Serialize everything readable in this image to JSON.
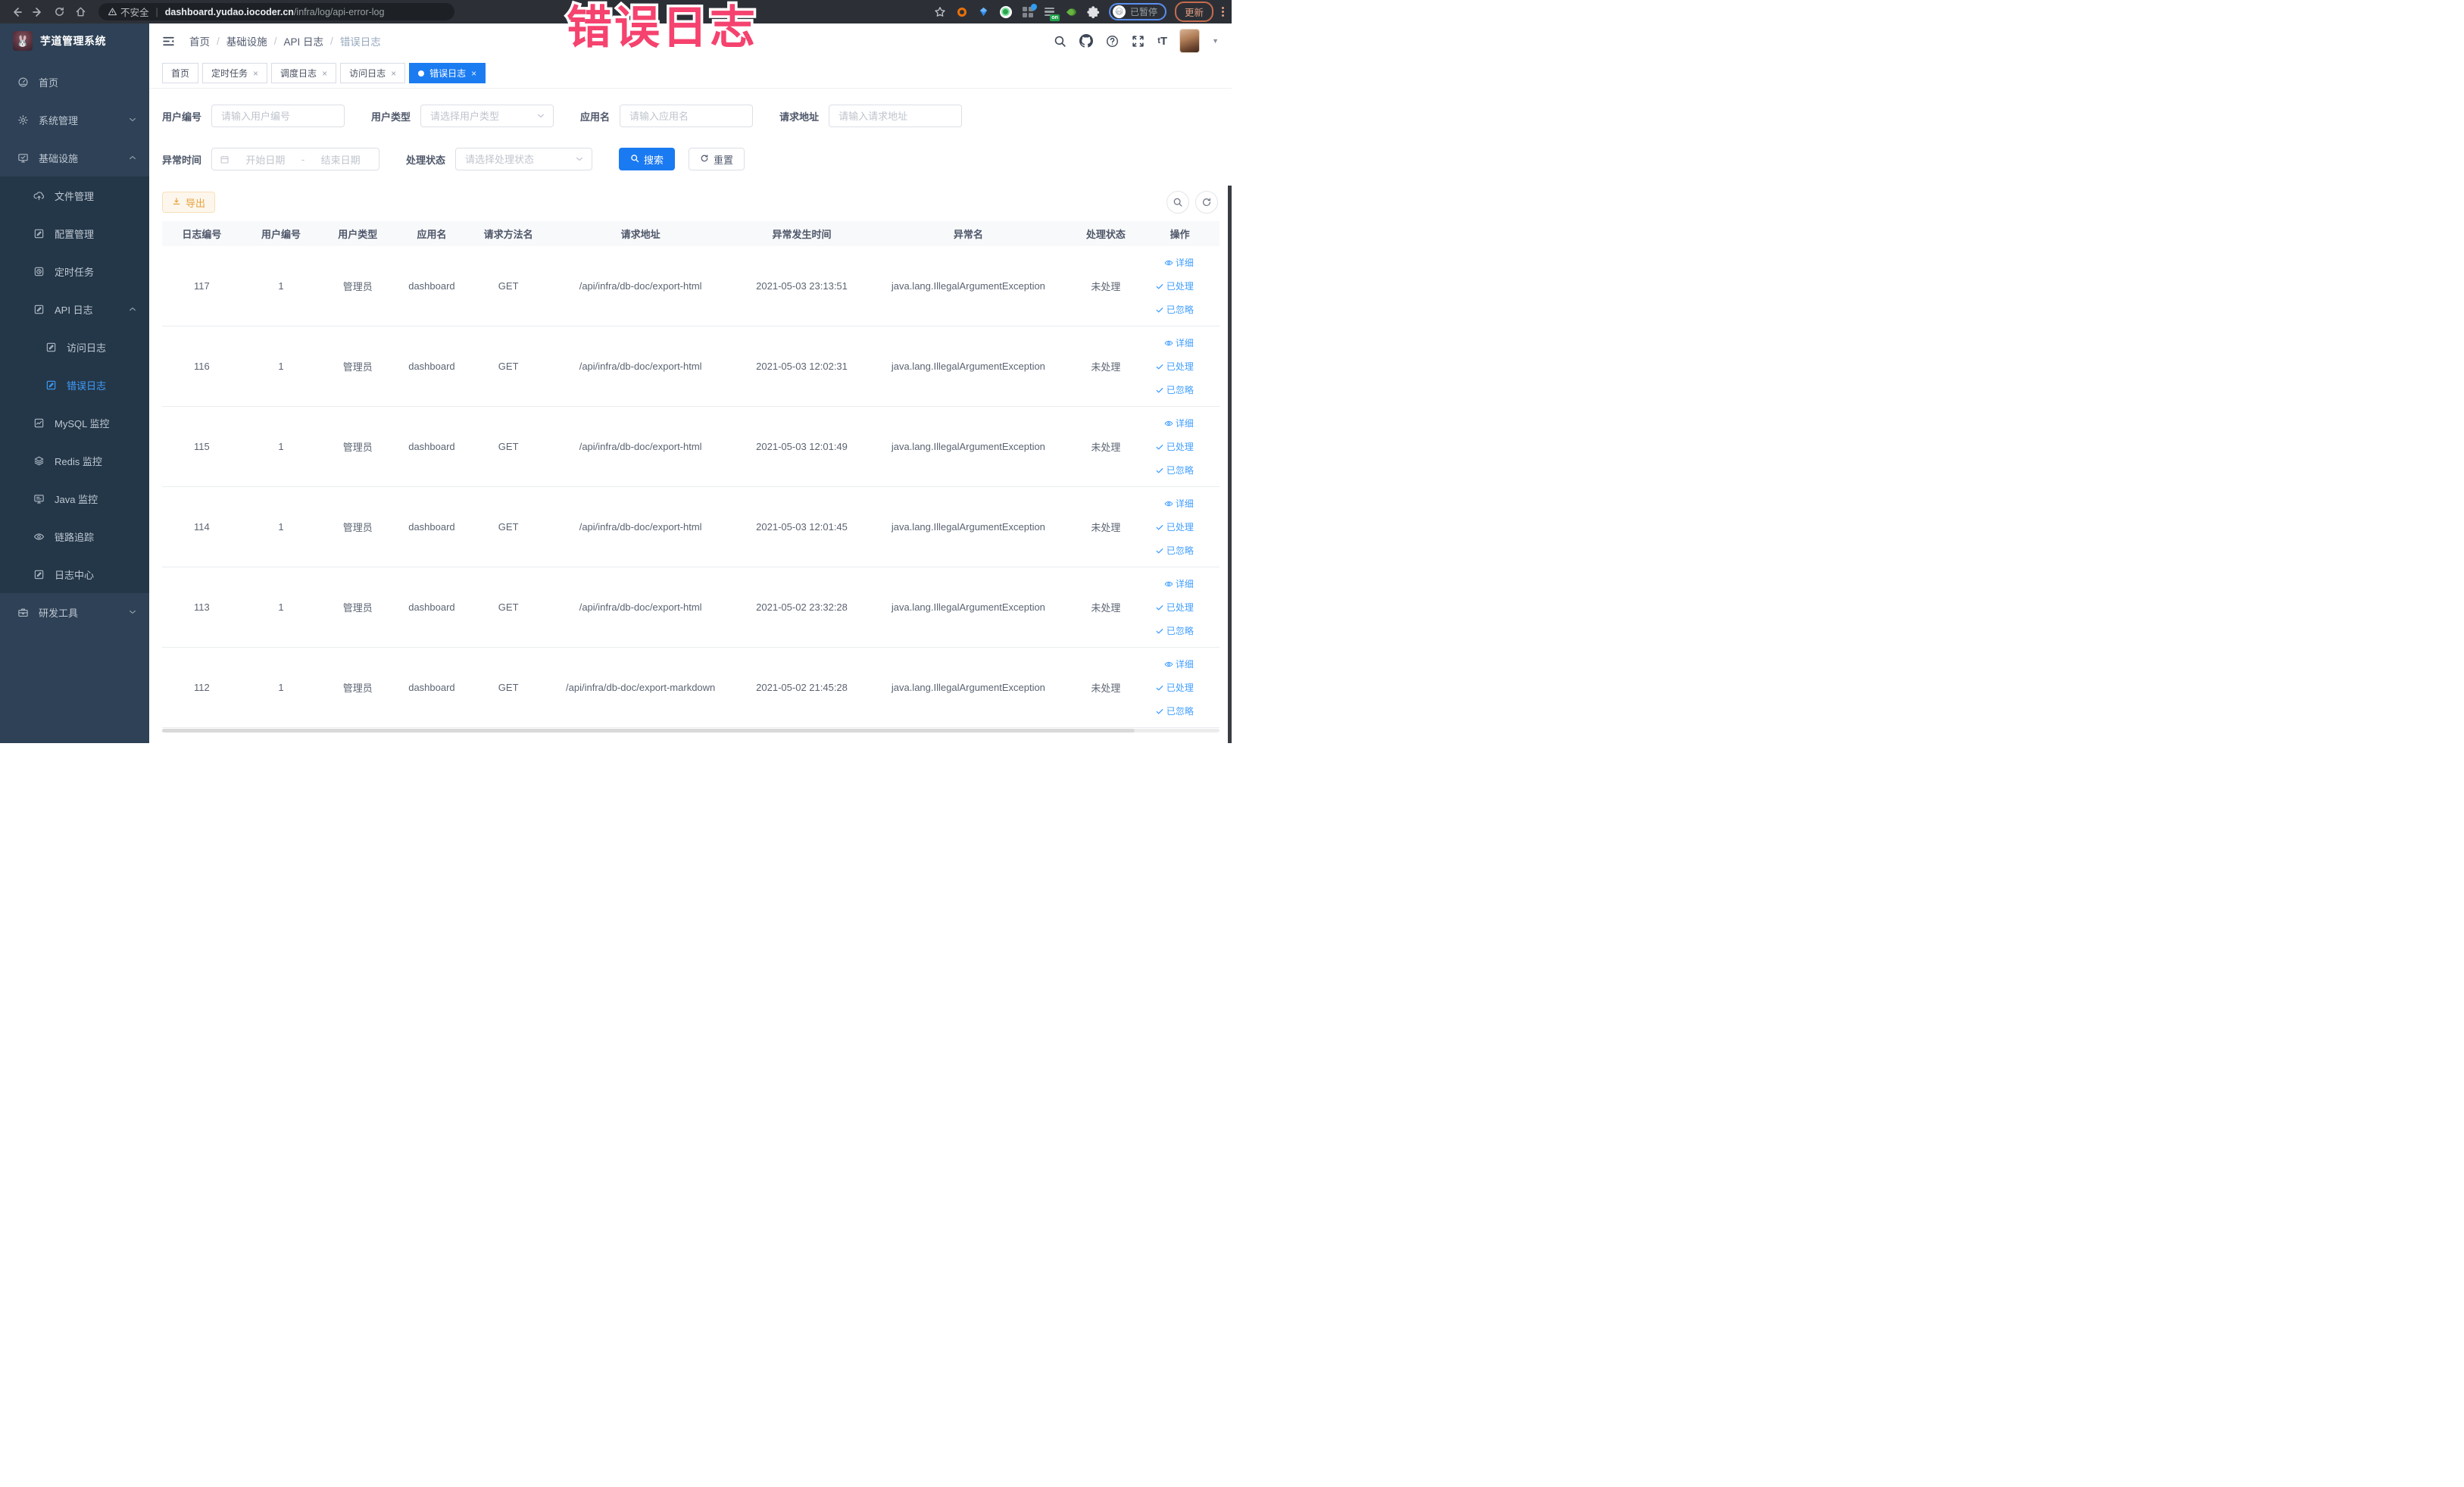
{
  "annotation": {
    "text": "错误日志",
    "color": "#f5426e"
  },
  "browser": {
    "security_label": "不安全",
    "url_host": "dashboard.yudao.iocoder.cn",
    "url_path": "/infra/log/api-error-log",
    "paused_label": "已暂停",
    "update_label": "更新"
  },
  "sidebar": {
    "logo_title": "芋道管理系统",
    "logo_emoji": "🐰",
    "items": [
      {
        "key": "home",
        "label": "首页",
        "icon": "dashboard-icon",
        "level": 1
      },
      {
        "key": "system",
        "label": "系统管理",
        "icon": "gear-icon",
        "level": 1,
        "chevron": "down"
      },
      {
        "key": "infra",
        "label": "基础设施",
        "icon": "monitor-icon",
        "level": 1,
        "chevron": "up"
      },
      {
        "key": "file",
        "label": "文件管理",
        "icon": "upload-icon",
        "level": 2
      },
      {
        "key": "config",
        "label": "配置管理",
        "icon": "edit-icon",
        "level": 2
      },
      {
        "key": "job",
        "label": "定时任务",
        "icon": "timer-icon",
        "level": 2
      },
      {
        "key": "api-log",
        "label": "API 日志",
        "icon": "edit-icon",
        "level": 2,
        "chevron": "up"
      },
      {
        "key": "access-log",
        "label": "访问日志",
        "icon": "edit-icon",
        "level": 3
      },
      {
        "key": "error-log",
        "label": "错误日志",
        "icon": "edit-icon",
        "level": 3,
        "active": true
      },
      {
        "key": "mysql",
        "label": "MySQL 监控",
        "icon": "chart-icon",
        "level": 2
      },
      {
        "key": "redis",
        "label": "Redis 监控",
        "icon": "layers-icon",
        "level": 2
      },
      {
        "key": "java",
        "label": "Java 监控",
        "icon": "java-icon",
        "level": 2
      },
      {
        "key": "tracer",
        "label": "链路追踪",
        "icon": "eye-icon",
        "level": 2
      },
      {
        "key": "log-center",
        "label": "日志中心",
        "icon": "edit-icon",
        "level": 2
      },
      {
        "key": "dev-tools",
        "label": "研发工具",
        "icon": "briefcase-icon",
        "level": 1,
        "chevron": "down"
      }
    ]
  },
  "header": {
    "breadcrumb": [
      "首页",
      "基础设施",
      "API 日志",
      "错误日志"
    ]
  },
  "tabs": [
    {
      "key": "home",
      "label": "首页",
      "closable": false
    },
    {
      "key": "job",
      "label": "定时任务",
      "closable": true
    },
    {
      "key": "job-log",
      "label": "调度日志",
      "closable": true
    },
    {
      "key": "access-log",
      "label": "访问日志",
      "closable": true
    },
    {
      "key": "error-log",
      "label": "错误日志",
      "closable": true,
      "active": true
    }
  ],
  "filters": {
    "user_id": {
      "label": "用户编号",
      "placeholder": "请输入用户编号"
    },
    "user_type": {
      "label": "用户类型",
      "placeholder": "请选择用户类型"
    },
    "app_name": {
      "label": "应用名",
      "placeholder": "请输入应用名"
    },
    "url": {
      "label": "请求地址",
      "placeholder": "请输入请求地址"
    },
    "time": {
      "label": "异常时间",
      "start_placeholder": "开始日期",
      "separator": "-",
      "end_placeholder": "结束日期"
    },
    "status": {
      "label": "处理状态",
      "placeholder": "请选择处理状态"
    },
    "search_label": "搜索",
    "reset_label": "重置"
  },
  "toolbar": {
    "export_label": "导出"
  },
  "table": {
    "columns": [
      {
        "key": "id",
        "label": "日志编号",
        "width": 7.5
      },
      {
        "key": "user_id",
        "label": "用户编号",
        "width": 7.5
      },
      {
        "key": "user_type",
        "label": "用户类型",
        "width": 7
      },
      {
        "key": "app_name",
        "label": "应用名",
        "width": 7
      },
      {
        "key": "method",
        "label": "请求方法名",
        "width": 7.5
      },
      {
        "key": "url",
        "label": "请求地址",
        "width": 17.5
      },
      {
        "key": "time",
        "label": "异常发生时间",
        "width": 13
      },
      {
        "key": "exception",
        "label": "异常名",
        "width": 18.5
      },
      {
        "key": "status",
        "label": "处理状态",
        "width": 7.5
      },
      {
        "key": "actions",
        "label": "操作",
        "width": 6.5
      }
    ],
    "row_actions": [
      {
        "key": "detail",
        "label": "详细",
        "icon": "eye-sm-icon"
      },
      {
        "key": "processed",
        "label": "已处理",
        "icon": "check-icon"
      },
      {
        "key": "ignored",
        "label": "已忽略",
        "icon": "check-icon"
      }
    ],
    "rows": [
      {
        "id": "117",
        "user_id": "1",
        "user_type": "管理员",
        "app_name": "dashboard",
        "method": "GET",
        "url": "/api/infra/db-doc/export-html",
        "time": "2021-05-03 23:13:51",
        "exception": "java.lang.IllegalArgumentException",
        "status": "未处理"
      },
      {
        "id": "116",
        "user_id": "1",
        "user_type": "管理员",
        "app_name": "dashboard",
        "method": "GET",
        "url": "/api/infra/db-doc/export-html",
        "time": "2021-05-03 12:02:31",
        "exception": "java.lang.IllegalArgumentException",
        "status": "未处理"
      },
      {
        "id": "115",
        "user_id": "1",
        "user_type": "管理员",
        "app_name": "dashboard",
        "method": "GET",
        "url": "/api/infra/db-doc/export-html",
        "time": "2021-05-03 12:01:49",
        "exception": "java.lang.IllegalArgumentException",
        "status": "未处理"
      },
      {
        "id": "114",
        "user_id": "1",
        "user_type": "管理员",
        "app_name": "dashboard",
        "method": "GET",
        "url": "/api/infra/db-doc/export-html",
        "time": "2021-05-03 12:01:45",
        "exception": "java.lang.IllegalArgumentException",
        "status": "未处理"
      },
      {
        "id": "113",
        "user_id": "1",
        "user_type": "管理员",
        "app_name": "dashboard",
        "method": "GET",
        "url": "/api/infra/db-doc/export-html",
        "time": "2021-05-02 23:32:28",
        "exception": "java.lang.IllegalArgumentException",
        "status": "未处理"
      },
      {
        "id": "112",
        "user_id": "1",
        "user_type": "管理员",
        "app_name": "dashboard",
        "method": "GET",
        "url": "/api/infra/db-doc/export-markdown",
        "time": "2021-05-02 21:45:28",
        "exception": "java.lang.IllegalArgumentException",
        "status": "未处理"
      }
    ]
  }
}
